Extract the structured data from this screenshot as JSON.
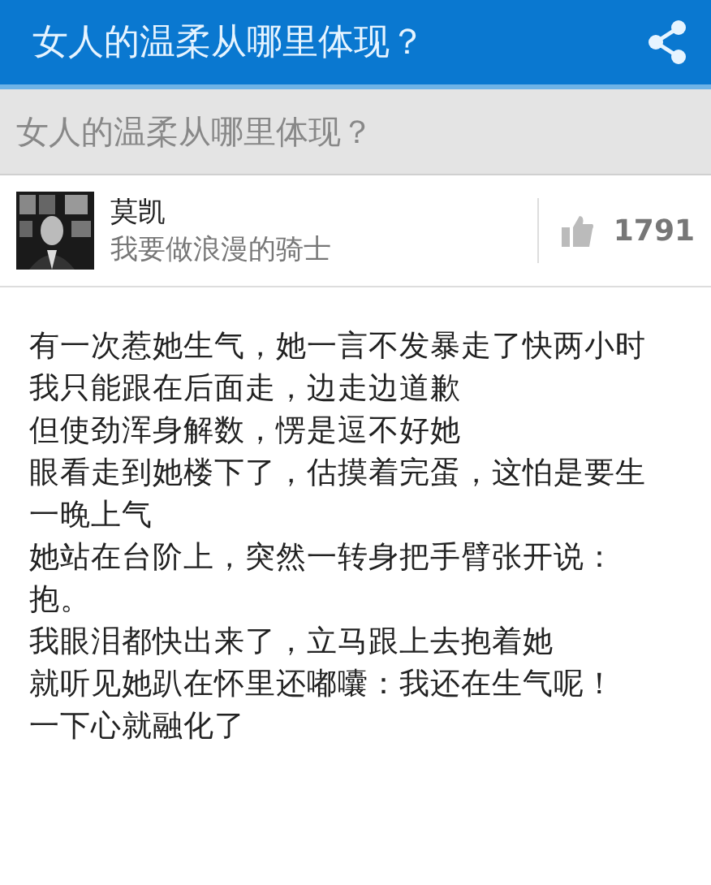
{
  "header": {
    "title": "女人的温柔从哪里体现？"
  },
  "question": {
    "title": "女人的温柔从哪里体现？"
  },
  "answer": {
    "author": "莫凯",
    "bio": "我要做浪漫的骑士",
    "likes": "1791",
    "lines": [
      "有一次惹她生气，她一言不发暴走了快两小时",
      "我只能跟在后面走，边走边道歉",
      "但使劲浑身解数，愣是逗不好她",
      "眼看走到她楼下了，估摸着完蛋，这怕是要生",
      "一晚上气",
      "她站在台阶上，突然一转身把手臂张开说：",
      "抱。",
      "我眼泪都快出来了，立马跟上去抱着她",
      "就听见她趴在怀里还嘟囔：我还在生气呢！",
      "一下心就融化了"
    ]
  }
}
